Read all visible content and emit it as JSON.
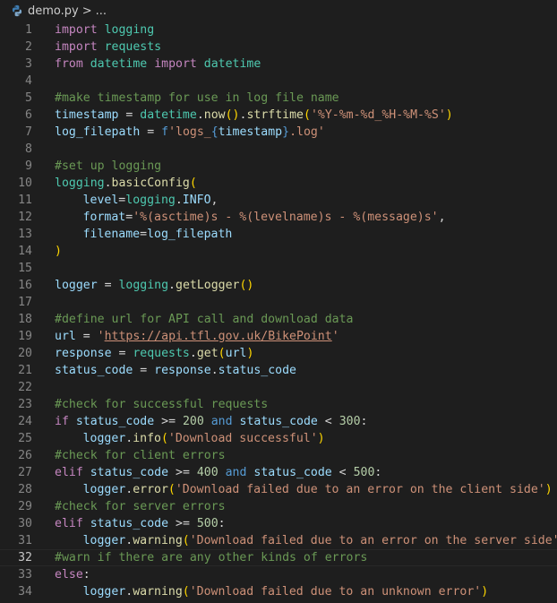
{
  "breadcrumb": {
    "file": "demo.py",
    "separator": ">",
    "ellipsis": "..."
  },
  "code_lines": [
    {
      "n": "1",
      "tokens": [
        [
          "kw",
          "import"
        ],
        [
          "op",
          " "
        ],
        [
          "bi",
          "logging"
        ]
      ]
    },
    {
      "n": "2",
      "tokens": [
        [
          "kw",
          "import"
        ],
        [
          "op",
          " "
        ],
        [
          "bi",
          "requests"
        ]
      ]
    },
    {
      "n": "3",
      "tokens": [
        [
          "kw",
          "from"
        ],
        [
          "op",
          " "
        ],
        [
          "bi",
          "datetime"
        ],
        [
          "op",
          " "
        ],
        [
          "kw",
          "import"
        ],
        [
          "op",
          " "
        ],
        [
          "bi",
          "datetime"
        ]
      ]
    },
    {
      "n": "4",
      "tokens": []
    },
    {
      "n": "5",
      "tokens": [
        [
          "com",
          "#make timestamp for use in log file name"
        ]
      ]
    },
    {
      "n": "6",
      "tokens": [
        [
          "var",
          "timestamp"
        ],
        [
          "op",
          " = "
        ],
        [
          "bi",
          "datetime"
        ],
        [
          "op",
          "."
        ],
        [
          "fn",
          "now"
        ],
        [
          "p1",
          "()"
        ],
        [
          "op",
          "."
        ],
        [
          "fn",
          "strftime"
        ],
        [
          "p1",
          "("
        ],
        [
          "str",
          "'%Y-%m-%d_%H-%M-%S'"
        ],
        [
          "p1",
          ")"
        ]
      ]
    },
    {
      "n": "7",
      "tokens": [
        [
          "var",
          "log_filepath"
        ],
        [
          "op",
          " = "
        ],
        [
          "fk",
          "f"
        ],
        [
          "str",
          "'logs_"
        ],
        [
          "fk",
          "{"
        ],
        [
          "var",
          "timestamp"
        ],
        [
          "fk",
          "}"
        ],
        [
          "str",
          ".log'"
        ]
      ]
    },
    {
      "n": "8",
      "tokens": []
    },
    {
      "n": "9",
      "tokens": [
        [
          "com",
          "#set up logging"
        ]
      ]
    },
    {
      "n": "10",
      "tokens": [
        [
          "bi",
          "logging"
        ],
        [
          "op",
          "."
        ],
        [
          "fn",
          "basicConfig"
        ],
        [
          "p1",
          "("
        ]
      ]
    },
    {
      "n": "11",
      "indent": 1,
      "tokens": [
        [
          "var",
          "level"
        ],
        [
          "op",
          "="
        ],
        [
          "bi",
          "logging"
        ],
        [
          "op",
          "."
        ],
        [
          "var",
          "INFO"
        ],
        [
          "op",
          ","
        ]
      ]
    },
    {
      "n": "12",
      "indent": 1,
      "tokens": [
        [
          "var",
          "format"
        ],
        [
          "op",
          "="
        ],
        [
          "str",
          "'%(asctime)s - %(levelname)s - %(message)s'"
        ],
        [
          "op",
          ","
        ]
      ]
    },
    {
      "n": "13",
      "indent": 1,
      "tokens": [
        [
          "var",
          "filename"
        ],
        [
          "op",
          "="
        ],
        [
          "var",
          "log_filepath"
        ]
      ]
    },
    {
      "n": "14",
      "tokens": [
        [
          "p1",
          ")"
        ]
      ]
    },
    {
      "n": "15",
      "tokens": []
    },
    {
      "n": "16",
      "tokens": [
        [
          "var",
          "logger"
        ],
        [
          "op",
          " = "
        ],
        [
          "bi",
          "logging"
        ],
        [
          "op",
          "."
        ],
        [
          "fn",
          "getLogger"
        ],
        [
          "p1",
          "()"
        ]
      ]
    },
    {
      "n": "17",
      "tokens": []
    },
    {
      "n": "18",
      "tokens": [
        [
          "com",
          "#define url for API call and download data"
        ]
      ]
    },
    {
      "n": "19",
      "tokens": [
        [
          "var",
          "url"
        ],
        [
          "op",
          " = "
        ],
        [
          "str",
          "'"
        ],
        [
          "str url",
          "https://api.tfl.gov.uk/BikePoint"
        ],
        [
          "str",
          "'"
        ]
      ]
    },
    {
      "n": "20",
      "tokens": [
        [
          "var",
          "response"
        ],
        [
          "op",
          " = "
        ],
        [
          "bi",
          "requests"
        ],
        [
          "op",
          "."
        ],
        [
          "fn",
          "get"
        ],
        [
          "p1",
          "("
        ],
        [
          "var",
          "url"
        ],
        [
          "p1",
          ")"
        ]
      ]
    },
    {
      "n": "21",
      "tokens": [
        [
          "var",
          "status_code"
        ],
        [
          "op",
          " = "
        ],
        [
          "var",
          "response"
        ],
        [
          "op",
          "."
        ],
        [
          "var",
          "status_code"
        ]
      ]
    },
    {
      "n": "22",
      "tokens": []
    },
    {
      "n": "23",
      "tokens": [
        [
          "com",
          "#check for successful requests"
        ]
      ]
    },
    {
      "n": "24",
      "tokens": [
        [
          "kw",
          "if"
        ],
        [
          "op",
          " "
        ],
        [
          "var",
          "status_code"
        ],
        [
          "op",
          " >= "
        ],
        [
          "num",
          "200"
        ],
        [
          "op",
          " "
        ],
        [
          "fk",
          "and"
        ],
        [
          "op",
          " "
        ],
        [
          "var",
          "status_code"
        ],
        [
          "op",
          " < "
        ],
        [
          "num",
          "300"
        ],
        [
          "op",
          ":"
        ]
      ]
    },
    {
      "n": "25",
      "indent": 1,
      "tokens": [
        [
          "var",
          "logger"
        ],
        [
          "op",
          "."
        ],
        [
          "fn",
          "info"
        ],
        [
          "p1",
          "("
        ],
        [
          "str",
          "'Download successful'"
        ],
        [
          "p1",
          ")"
        ]
      ]
    },
    {
      "n": "26",
      "tokens": [
        [
          "com",
          "#check for client errors"
        ]
      ]
    },
    {
      "n": "27",
      "tokens": [
        [
          "kw",
          "elif"
        ],
        [
          "op",
          " "
        ],
        [
          "var",
          "status_code"
        ],
        [
          "op",
          " >= "
        ],
        [
          "num",
          "400"
        ],
        [
          "op",
          " "
        ],
        [
          "fk",
          "and"
        ],
        [
          "op",
          " "
        ],
        [
          "var",
          "status_code"
        ],
        [
          "op",
          " < "
        ],
        [
          "num",
          "500"
        ],
        [
          "op",
          ":"
        ]
      ]
    },
    {
      "n": "28",
      "indent": 1,
      "tokens": [
        [
          "var",
          "logger"
        ],
        [
          "op",
          "."
        ],
        [
          "fn",
          "error"
        ],
        [
          "p1",
          "("
        ],
        [
          "str",
          "'Download failed due to an error on the client side'"
        ],
        [
          "p1",
          ")"
        ]
      ]
    },
    {
      "n": "29",
      "tokens": [
        [
          "com",
          "#check for server errors"
        ]
      ]
    },
    {
      "n": "30",
      "tokens": [
        [
          "kw",
          "elif"
        ],
        [
          "op",
          " "
        ],
        [
          "var",
          "status_code"
        ],
        [
          "op",
          " >= "
        ],
        [
          "num",
          "500"
        ],
        [
          "op",
          ":"
        ]
      ]
    },
    {
      "n": "31",
      "indent": 1,
      "tokens": [
        [
          "var",
          "logger"
        ],
        [
          "op",
          "."
        ],
        [
          "fn",
          "warning"
        ],
        [
          "p1",
          "("
        ],
        [
          "str",
          "'Download failed due to an error on the server side'"
        ],
        [
          "p1",
          ")"
        ]
      ]
    },
    {
      "n": "32",
      "current": true,
      "tokens": [
        [
          "com",
          "#warn if there are any other kinds of errors"
        ]
      ]
    },
    {
      "n": "33",
      "tokens": [
        [
          "kw",
          "else"
        ],
        [
          "op",
          ":"
        ]
      ]
    },
    {
      "n": "34",
      "indent": 1,
      "tokens": [
        [
          "var",
          "logger"
        ],
        [
          "op",
          "."
        ],
        [
          "fn",
          "warning"
        ],
        [
          "p1",
          "("
        ],
        [
          "str",
          "'Download failed due to an unknown error'"
        ],
        [
          "p1",
          ")"
        ]
      ]
    }
  ]
}
